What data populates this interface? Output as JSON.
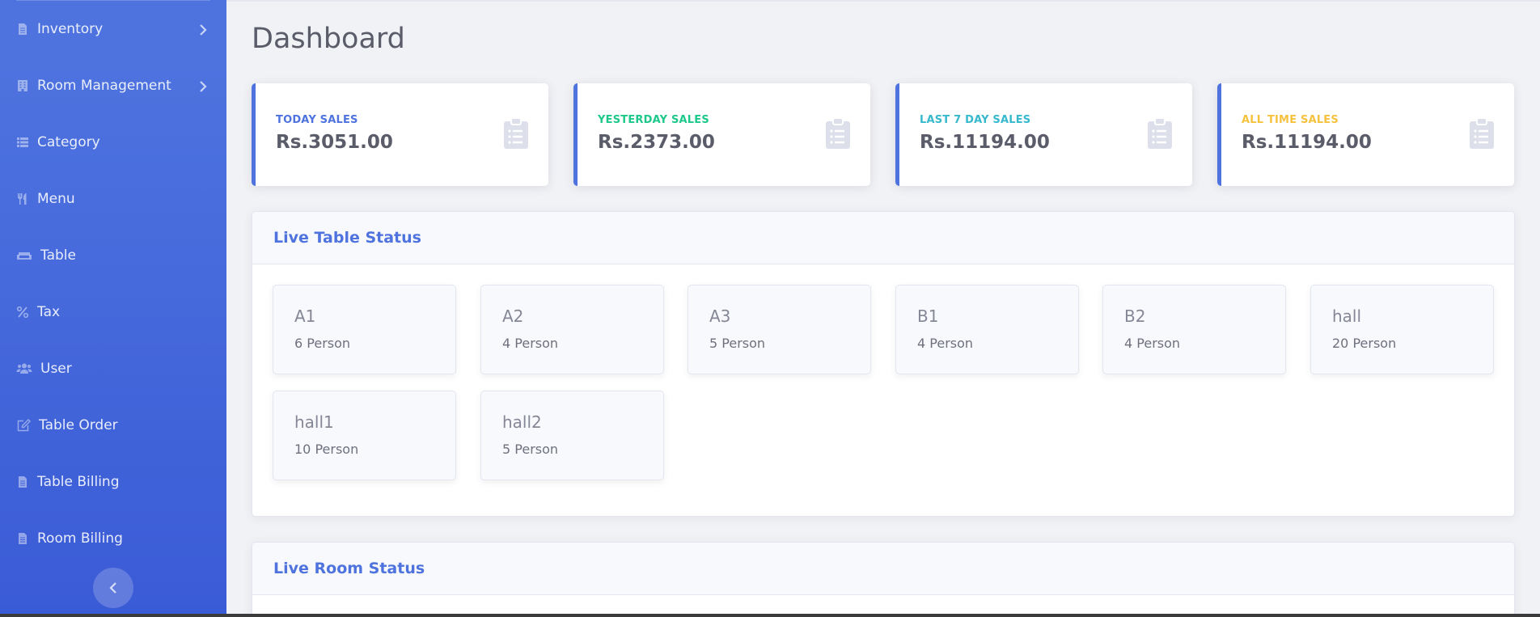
{
  "sidebar": {
    "items": [
      {
        "label": "Inventory",
        "icon": "file-icon",
        "has_submenu": true
      },
      {
        "label": "Room Management",
        "icon": "building-icon",
        "has_submenu": true
      },
      {
        "label": "Category",
        "icon": "list-icon",
        "has_submenu": false
      },
      {
        "label": "Menu",
        "icon": "utensils-icon",
        "has_submenu": false
      },
      {
        "label": "Table",
        "icon": "couch-icon",
        "has_submenu": false
      },
      {
        "label": "Tax",
        "icon": "percent-icon",
        "has_submenu": false
      },
      {
        "label": "User",
        "icon": "users-icon",
        "has_submenu": false
      },
      {
        "label": "Table Order",
        "icon": "edit-icon",
        "has_submenu": false
      },
      {
        "label": "Table Billing",
        "icon": "file-icon",
        "has_submenu": false
      },
      {
        "label": "Room Billing",
        "icon": "file-icon",
        "has_submenu": false
      }
    ],
    "toggle_icon": "chevron-left-icon"
  },
  "page": {
    "title": "Dashboard"
  },
  "stats": [
    {
      "label": "TODAY SALES",
      "value": "Rs.3051.00",
      "color": "#4e73df",
      "icon": "clipboard-list-icon"
    },
    {
      "label": "YESTERDAY SALES",
      "value": "Rs.2373.00",
      "color": "#1cc88a",
      "icon": "clipboard-list-icon"
    },
    {
      "label": "LAST 7 DAY SALES",
      "value": "Rs.11194.00",
      "color": "#36b9cc",
      "icon": "clipboard-list-icon"
    },
    {
      "label": "ALL TIME SALES",
      "value": "Rs.11194.00",
      "color": "#f6c23e",
      "icon": "clipboard-list-icon"
    }
  ],
  "live_table_status": {
    "title": "Live Table Status",
    "tables": [
      {
        "name": "A1",
        "capacity": "6 Person"
      },
      {
        "name": "A2",
        "capacity": "4 Person"
      },
      {
        "name": "A3",
        "capacity": "5 Person"
      },
      {
        "name": "B1",
        "capacity": "4 Person"
      },
      {
        "name": "B2",
        "capacity": "4 Person"
      },
      {
        "name": "hall",
        "capacity": "20 Person"
      },
      {
        "name": "hall1",
        "capacity": "10 Person"
      },
      {
        "name": "hall2",
        "capacity": "5 Person"
      }
    ]
  },
  "live_room_status": {
    "title": "Live Room Status"
  },
  "colors": {
    "primary": "#4e73df",
    "success": "#1cc88a",
    "info": "#36b9cc",
    "warning": "#f6c23e",
    "text": "#5a5c69"
  }
}
